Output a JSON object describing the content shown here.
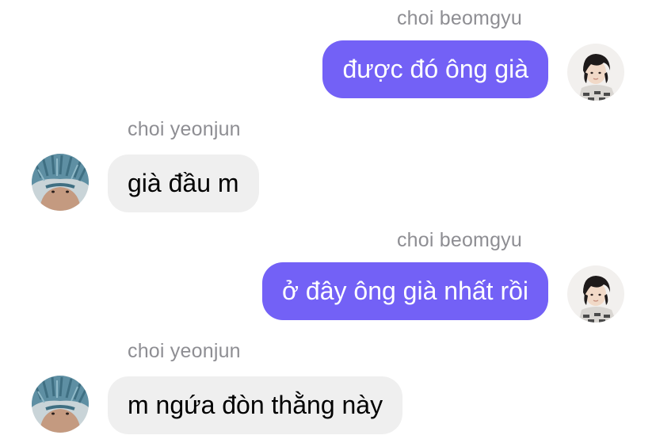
{
  "messages": [
    {
      "direction": "outgoing",
      "sender": "choi beomgyu",
      "text": "được đó ông già"
    },
    {
      "direction": "incoming",
      "sender": "choi yeonjun",
      "text": "già đầu m"
    },
    {
      "direction": "outgoing",
      "sender": "choi beomgyu",
      "text": "ở đây ông già nhất rồi"
    },
    {
      "direction": "incoming",
      "sender": "choi yeonjun",
      "text": "m ngứa đòn thằng này"
    }
  ],
  "colors": {
    "outgoing_bubble": "#7361f6",
    "incoming_bubble": "#efefef",
    "sender_name": "#8e8e93"
  }
}
